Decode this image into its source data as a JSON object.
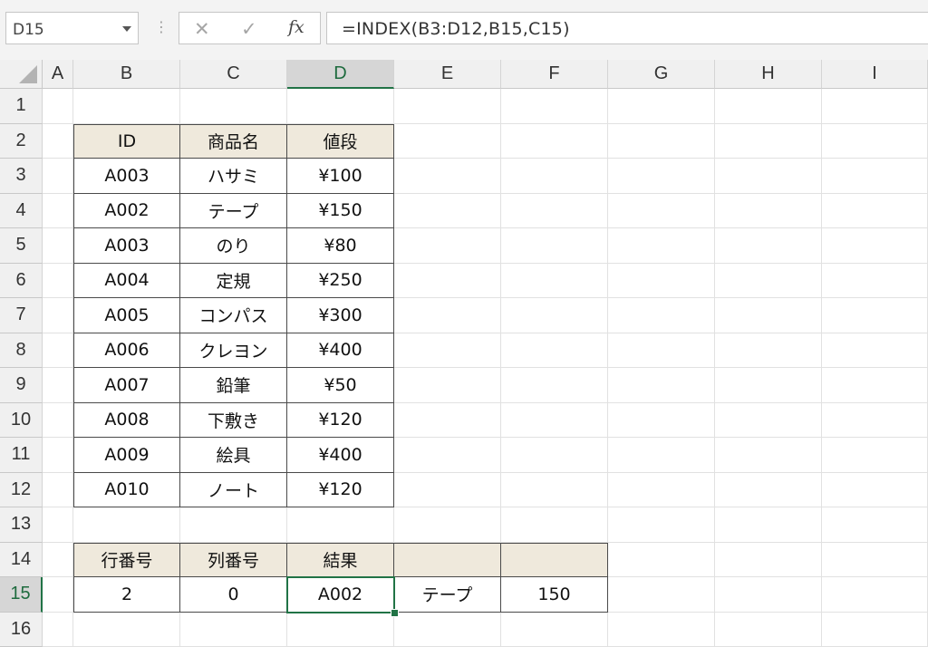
{
  "name_box": {
    "value": "D15"
  },
  "formula": {
    "fx_label": "fx",
    "value": "=INDEX(B3:D12,B15,C15)"
  },
  "columns": [
    "A",
    "B",
    "C",
    "D",
    "E",
    "F",
    "G",
    "H",
    "I"
  ],
  "rows": [
    "1",
    "2",
    "3",
    "4",
    "5",
    "6",
    "7",
    "8",
    "9",
    "10",
    "11",
    "12",
    "13",
    "14",
    "15",
    "16"
  ],
  "selected_cell": {
    "col": "D",
    "row": "15"
  },
  "cells": [
    {
      "ref": "B2",
      "value": "ID",
      "style": "head"
    },
    {
      "ref": "C2",
      "value": "商品名",
      "style": "head"
    },
    {
      "ref": "D2",
      "value": "値段",
      "style": "head"
    },
    {
      "ref": "B3",
      "value": "A003"
    },
    {
      "ref": "C3",
      "value": "ハサミ"
    },
    {
      "ref": "D3",
      "value": "¥100"
    },
    {
      "ref": "B4",
      "value": "A002"
    },
    {
      "ref": "C4",
      "value": "テープ"
    },
    {
      "ref": "D4",
      "value": "¥150"
    },
    {
      "ref": "B5",
      "value": "A003"
    },
    {
      "ref": "C5",
      "value": "のり"
    },
    {
      "ref": "D5",
      "value": "¥80"
    },
    {
      "ref": "B6",
      "value": "A004"
    },
    {
      "ref": "C6",
      "value": "定規"
    },
    {
      "ref": "D6",
      "value": "¥250"
    },
    {
      "ref": "B7",
      "value": "A005"
    },
    {
      "ref": "C7",
      "value": "コンパス"
    },
    {
      "ref": "D7",
      "value": "¥300"
    },
    {
      "ref": "B8",
      "value": "A006"
    },
    {
      "ref": "C8",
      "value": "クレヨン"
    },
    {
      "ref": "D8",
      "value": "¥400"
    },
    {
      "ref": "B9",
      "value": "A007"
    },
    {
      "ref": "C9",
      "value": "鉛筆"
    },
    {
      "ref": "D9",
      "value": "¥50"
    },
    {
      "ref": "B10",
      "value": "A008"
    },
    {
      "ref": "C10",
      "value": "下敷き"
    },
    {
      "ref": "D10",
      "value": "¥120"
    },
    {
      "ref": "B11",
      "value": "A009"
    },
    {
      "ref": "C11",
      "value": "絵具"
    },
    {
      "ref": "D11",
      "value": "¥400"
    },
    {
      "ref": "B12",
      "value": "A010"
    },
    {
      "ref": "C12",
      "value": "ノート"
    },
    {
      "ref": "D12",
      "value": "¥120"
    },
    {
      "ref": "B14",
      "value": "行番号",
      "style": "head"
    },
    {
      "ref": "C14",
      "value": "列番号",
      "style": "head"
    },
    {
      "ref": "D14",
      "value": "結果",
      "style": "head"
    },
    {
      "ref": "E14",
      "value": "",
      "style": "head"
    },
    {
      "ref": "F14",
      "value": "",
      "style": "head"
    },
    {
      "ref": "B15",
      "value": "2"
    },
    {
      "ref": "C15",
      "value": "0"
    },
    {
      "ref": "D15",
      "value": "A002"
    },
    {
      "ref": "E15",
      "value": "テープ"
    },
    {
      "ref": "F15",
      "value": "150"
    }
  ],
  "colors": {
    "selection": "#217346",
    "header_fill": "#efe9dc"
  }
}
